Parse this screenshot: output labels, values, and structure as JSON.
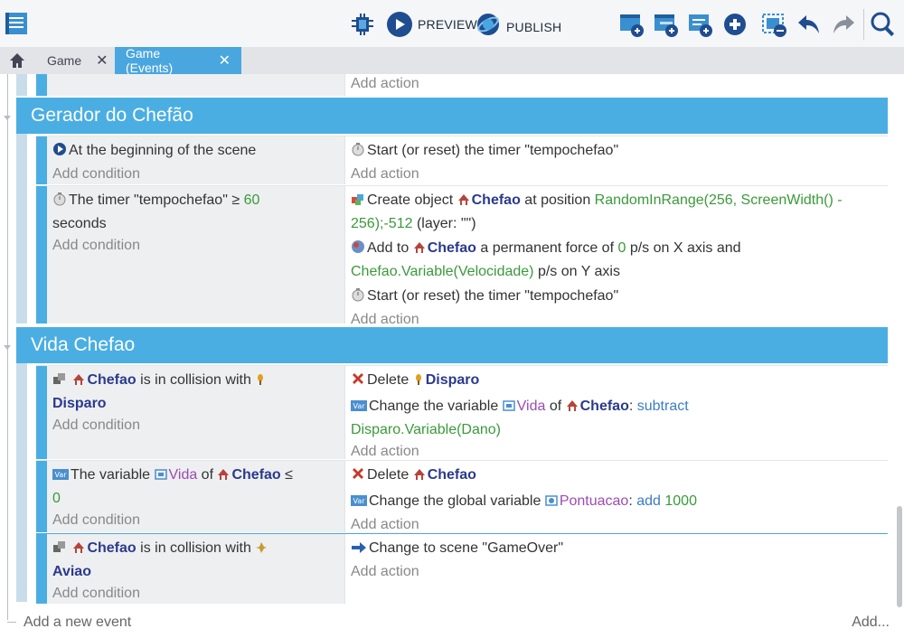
{
  "toolbar": {
    "preview_label": "PREVIEW",
    "publish_label": "PUBLISH"
  },
  "tabs": [
    {
      "label": "Game",
      "close": "✕"
    },
    {
      "label": "Game (Events)",
      "close": "✕"
    }
  ],
  "top_stub": {
    "add_action": "Add action"
  },
  "groups": [
    {
      "title": "Gerador do Chefão"
    },
    {
      "title": "Vida Chefao"
    }
  ],
  "events": {
    "e1": {
      "cond": "At the beginning of the scene",
      "add_condition": "Add condition",
      "action": "Start (or reset) the timer \"tempochefao\"",
      "add_action": "Add action"
    },
    "e2": {
      "cond_prefix": "The timer \"tempochefao\" ≥ ",
      "cond_num": "60",
      "cond_suffix": "seconds",
      "add_condition": "Add condition",
      "a1_prefix": "Create object ",
      "a1_obj": "Chefao",
      "a1_mid": " at position ",
      "a1_expr": "RandomInRange(256, ScreenWidth() - 256);-512",
      "a1_suffix": " (layer: \"\")",
      "a2_prefix": "Add to ",
      "a2_obj": "Chefao",
      "a2_mid1": " a permanent force of ",
      "a2_num": "0",
      "a2_mid2": " p/s on X axis and ",
      "a2_expr": "Chefao.Variable(Velocidade)",
      "a2_suffix": " p/s on Y axis",
      "a3": "Start (or reset) the timer \"tempochefao\"",
      "add_action": "Add action"
    },
    "e3": {
      "cond_obj": "Chefao",
      "cond_mid": " is in collision with ",
      "cond_obj2": "Disparo",
      "add_condition": "Add condition",
      "a1_prefix": "Delete ",
      "a1_obj": "Disparo",
      "a2_prefix": "Change the variable ",
      "a2_var": "Vida",
      "a2_of": " of ",
      "a2_obj": "Chefao",
      "a2_colon": ": ",
      "a2_op": "subtract",
      "a2_expr": "Disparo.Variable(Dano)",
      "add_action": "Add action"
    },
    "e4": {
      "cond_prefix": "The variable ",
      "cond_var": "Vida",
      "cond_of": " of ",
      "cond_obj": "Chefao",
      "cond_op": " ≤",
      "cond_num": "0",
      "add_condition": "Add condition",
      "a1_prefix": "Delete ",
      "a1_obj": "Chefao",
      "a2_prefix": "Change the global variable ",
      "a2_var": "Pontuacao",
      "a2_colon": ": ",
      "a2_op": "add",
      "a2_num": "1000",
      "add_action": "Add action"
    },
    "e5": {
      "cond_obj": "Chefao",
      "cond_mid": " is in collision with ",
      "cond_obj2": "Aviao",
      "add_condition": "Add condition",
      "a1": "Change to scene \"GameOver\"",
      "add_action": "Add action"
    }
  },
  "footer": {
    "add_event": "Add a new event",
    "add_more": "Add..."
  }
}
